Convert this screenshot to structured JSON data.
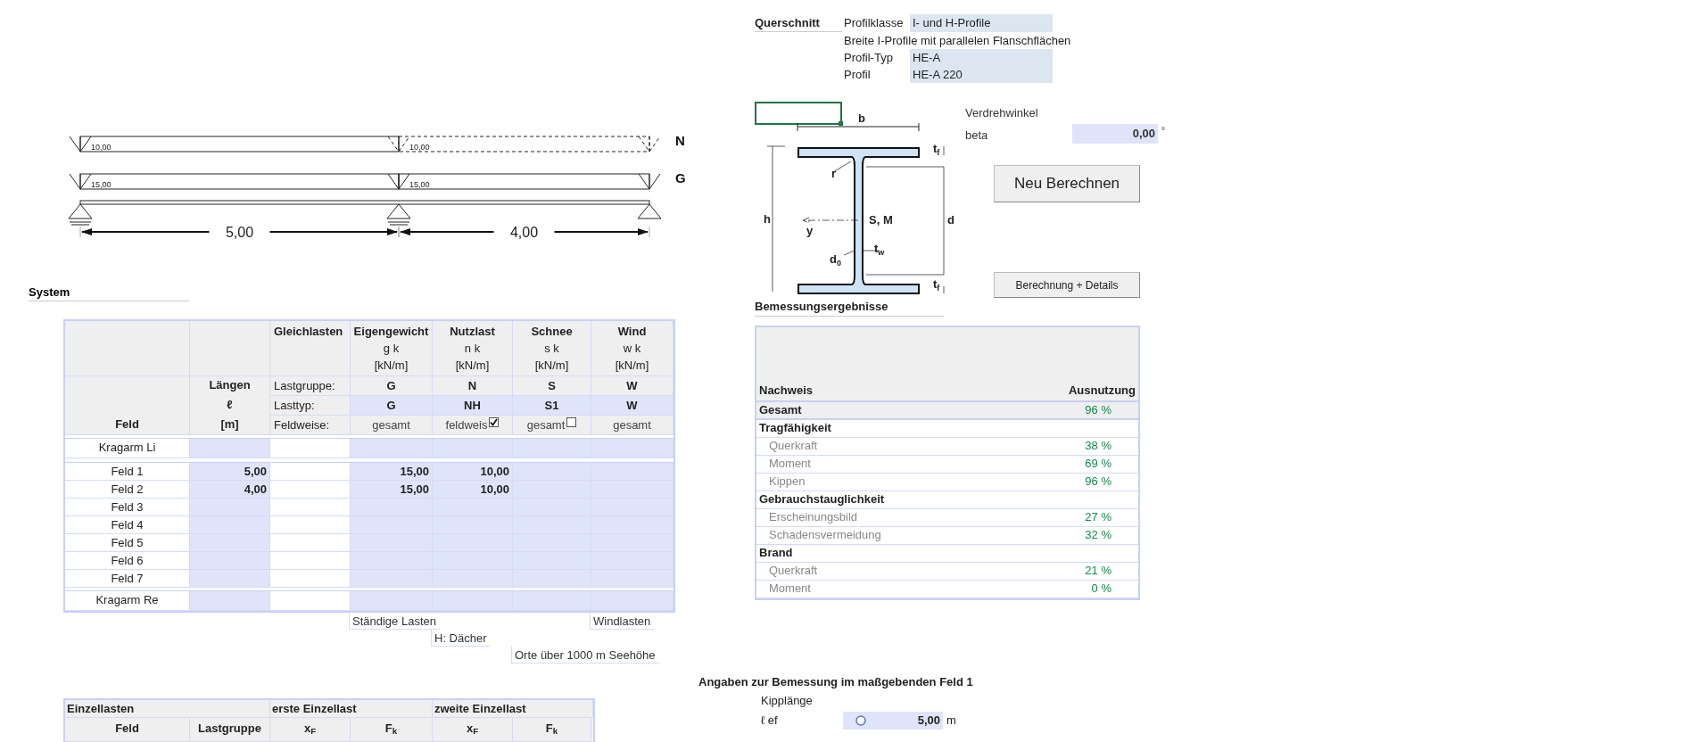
{
  "beam": {
    "load_rows": [
      {
        "label": "N",
        "spans": [
          {
            "value": "10,00",
            "active": true
          },
          {
            "value": "10,00",
            "active": false
          }
        ]
      },
      {
        "label": "G",
        "spans": [
          {
            "value": "15,00",
            "active": true
          },
          {
            "value": "15,00",
            "active": true
          }
        ]
      }
    ],
    "lengths": [
      "5,00",
      "4,00"
    ]
  },
  "system": {
    "title": "System"
  },
  "loads_table": {
    "field_header": "Feld",
    "length_header": [
      "Längen",
      "ℓ",
      "[m]"
    ],
    "uniform_header": "Gleichlasten",
    "property_labels": [
      "Lastgruppe:",
      "Lasttyp:",
      "Feldweise:"
    ],
    "load_columns": [
      {
        "kind": "plain",
        "name": "Eigengewicht",
        "symbol": "g k",
        "unit": "[kN/m]",
        "group": "G",
        "type": "G",
        "mode": "gesamt"
      },
      {
        "kind": "checkbox",
        "name": "Nutzlast",
        "symbol": "n k",
        "unit": "[kN/m]",
        "group": "N",
        "type": "NH",
        "mode": "feldweis",
        "checked": true
      },
      {
        "kind": "checkbox",
        "name": "Schnee",
        "symbol": "s k",
        "unit": "[kN/m]",
        "group": "S",
        "type": "S1",
        "mode": "gesamt",
        "checked": false
      },
      {
        "kind": "plain",
        "name": "Wind",
        "symbol": "w k",
        "unit": "[kN/m]",
        "group": "W",
        "type": "W",
        "mode": "gesamt"
      }
    ],
    "rows": [
      {
        "kind": "cantilever",
        "label": "Kragarm Li"
      },
      {
        "kind": "field",
        "label": "Feld 1",
        "length": "5,00",
        "loads": [
          "15,00",
          "10,00"
        ]
      },
      {
        "kind": "field",
        "label": "Feld 2",
        "length": "4,00",
        "loads": [
          "15,00",
          "10,00"
        ]
      },
      {
        "kind": "field",
        "label": "Feld 3"
      },
      {
        "kind": "field",
        "label": "Feld 4"
      },
      {
        "kind": "field",
        "label": "Feld 5"
      },
      {
        "kind": "field",
        "label": "Feld 6"
      },
      {
        "kind": "field",
        "label": "Feld 7"
      },
      {
        "kind": "cantilever",
        "label": "Kragarm Re"
      }
    ]
  },
  "load_notes": [
    "Ständige Lasten",
    "Windlasten",
    "H: Dächer",
    "Orte über 1000 m Seehöhe"
  ],
  "point_loads": {
    "title": "Einzellasten",
    "groups": [
      "erste Einzellast",
      "zweite Einzellast"
    ],
    "columns": [
      "Feld",
      "Lastgruppe",
      "x$_{F}$",
      "F$_{k}$",
      "x$_{F}$",
      "F$_{k}$"
    ]
  },
  "cross_section": {
    "title": "Querschnitt",
    "items": [
      {
        "kind": "field",
        "label": "Profilklasse",
        "value": "I- und H-Profile"
      },
      {
        "kind": "note",
        "text": "Breite I-Profile mit parallelen Flanschflächen"
      },
      {
        "kind": "field",
        "label": "Profil-Typ",
        "value": "HE-A"
      },
      {
        "kind": "field",
        "label": "Profil",
        "value": "HE-A 220"
      }
    ]
  },
  "section_drawing": {
    "labels": [
      {
        "text": "b"
      },
      {
        "text": "t",
        "sub": "f"
      },
      {
        "text": "r"
      },
      {
        "text": "h"
      },
      {
        "text": "y"
      },
      {
        "text": "S, M"
      },
      {
        "text": "d"
      },
      {
        "text": "t",
        "sub": "w"
      },
      {
        "text": "d",
        "sub": "0"
      },
      {
        "text": "t",
        "sub": "f"
      }
    ]
  },
  "rotation": {
    "title": "Verdrehwinkel",
    "label": "beta",
    "value": "0,00",
    "unit": "°"
  },
  "buttons": [
    "Neu Berechnen",
    "Berechnung + Details"
  ],
  "results": {
    "title": "Bemessungsergebnisse",
    "columns": [
      "Nachweis",
      "Ausnutzung"
    ],
    "rows": [
      {
        "kind": "total",
        "label": "Gesamt",
        "value": "96 %"
      },
      {
        "kind": "group",
        "label": "Tragfähigkeit"
      },
      {
        "kind": "item",
        "label": "Querkraft",
        "value": "38 %"
      },
      {
        "kind": "item",
        "label": "Moment",
        "value": "69 %"
      },
      {
        "kind": "item",
        "label": "Kippen",
        "value": "96 %"
      },
      {
        "kind": "group",
        "label": "Gebrauchstauglichkeit"
      },
      {
        "kind": "item",
        "label": "Erscheinungsbild",
        "value": "27 %"
      },
      {
        "kind": "item",
        "label": "Schadensvermeidung",
        "value": "32 %"
      },
      {
        "kind": "group",
        "label": "Brand"
      },
      {
        "kind": "item",
        "label": "Querkraft",
        "value": "21 %"
      },
      {
        "kind": "item",
        "label": "Moment",
        "value": "0 %"
      }
    ]
  },
  "design_info": {
    "title": "Angaben zur Bemessung im maßgebenden Feld 1",
    "label": "Kipplänge",
    "symbol": "ℓ ef",
    "value": "5,00",
    "unit": "m"
  }
}
